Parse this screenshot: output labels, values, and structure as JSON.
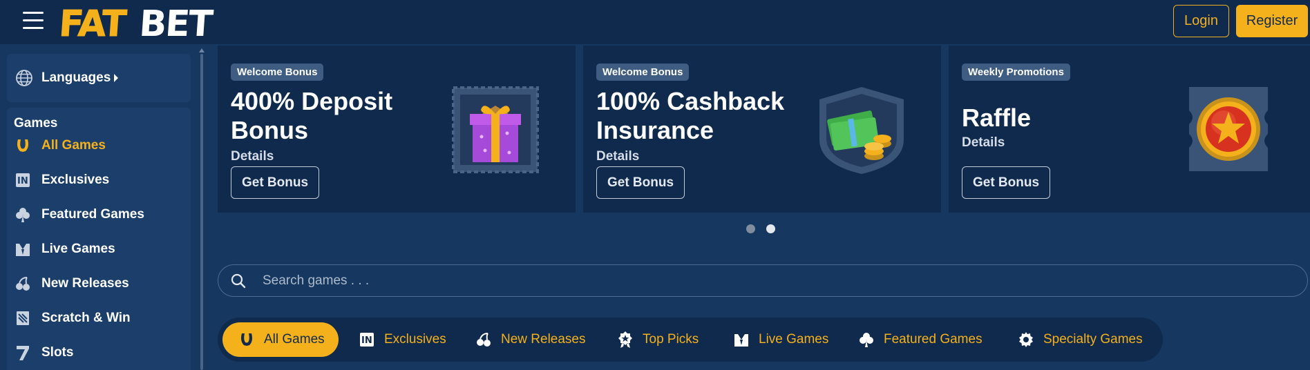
{
  "header": {
    "logo_text": "FATBET",
    "login_label": "Login",
    "register_label": "Register"
  },
  "sidebar": {
    "languages_label": "Languages",
    "games_title": "Games",
    "items": [
      {
        "label": "All Games",
        "icon": "horseshoe-icon",
        "active": true
      },
      {
        "label": "Exclusives",
        "icon": "exclusives-icon",
        "active": false
      },
      {
        "label": "Featured Games",
        "icon": "clover-icon",
        "active": false
      },
      {
        "label": "Live Games",
        "icon": "dealer-icon",
        "active": false
      },
      {
        "label": "New Releases",
        "icon": "cherry-icon",
        "active": false
      },
      {
        "label": "Scratch & Win",
        "icon": "scratch-card-icon",
        "active": false
      },
      {
        "label": "Slots",
        "icon": "seven-icon",
        "active": false
      }
    ]
  },
  "promos": [
    {
      "tag": "Welcome Bonus",
      "title_line1": "400% Deposit",
      "title_line2": "Bonus",
      "details": "Details",
      "button": "Get Bonus",
      "art": "gift-box-icon"
    },
    {
      "tag": "Welcome Bonus",
      "title_line1": "100% Cashback",
      "title_line2": "Insurance",
      "details": "Details",
      "button": "Get Bonus",
      "art": "cash-coins-icon"
    },
    {
      "tag": "Weekly Promotions",
      "title_line1": "Raffle",
      "title_line2": "",
      "details": "Details",
      "button": "Get Bonus",
      "art": "star-coin-icon"
    }
  ],
  "carousel": {
    "count": 2,
    "active_index": 1
  },
  "search": {
    "placeholder": "Search games . . ."
  },
  "tabs": [
    {
      "label": "All Games",
      "icon": "horseshoe-icon",
      "active": true
    },
    {
      "label": "Exclusives",
      "icon": "exclusives-icon",
      "active": false
    },
    {
      "label": "New Releases",
      "icon": "cherry-icon",
      "active": false
    },
    {
      "label": "Top Picks",
      "icon": "award-icon",
      "active": false
    },
    {
      "label": "Live Games",
      "icon": "dealer-icon",
      "active": false
    },
    {
      "label": "Featured Games",
      "icon": "clover-icon",
      "active": false
    },
    {
      "label": "Specialty Games",
      "icon": "gear-icon",
      "active": false
    }
  ],
  "colors": {
    "background": "#163760",
    "header": "#0f2a4d",
    "accent": "#f5b11c",
    "panel": "#1b3f6a"
  }
}
